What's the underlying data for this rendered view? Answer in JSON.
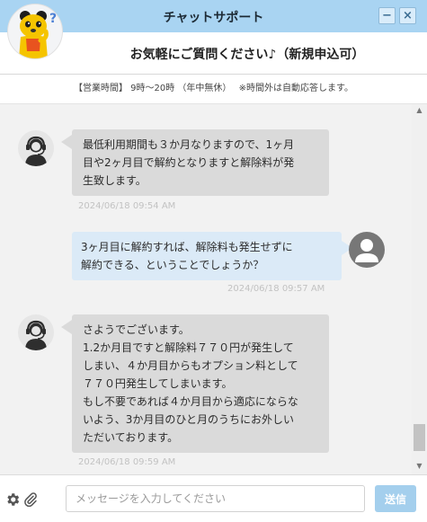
{
  "window": {
    "title": "チャットサポート",
    "minimize_glyph": "−",
    "close_glyph": "×"
  },
  "header": {
    "subtitle": "お気軽にご質問ください♪（新規申込可）",
    "mascot_icon": "bear-mascot-icon"
  },
  "hours": {
    "text": "【営業時間】 9時～20時 （年中無休）　 ※時間外は自動応答します。"
  },
  "messages": [
    {
      "sender": "operator",
      "text": "最低利用期間も３か月なりますので、1ヶ月\n目や2ヶ月目で解約となりますと解除料が発\n生致します。",
      "timestamp": "2024/06/18 09:54 AM"
    },
    {
      "sender": "user",
      "text": "3ヶ月目に解約すれば、解除料も発生せずに\n解約できる、ということでしょうか？",
      "timestamp": "2024/06/18 09:57 AM"
    },
    {
      "sender": "operator",
      "text": "さようでございます。\n1.2か月目ですと解除料７７０円が発生して\nしまい、４か月目からもオプション料として\n７７０円発生してしまいます。\nもし不要であれば４か月目から適応にならな\nいよう、3か月目のひと月のうちにお外しい\nただいております。",
      "timestamp": "2024/06/18 09:59 AM"
    }
  ],
  "footer": {
    "input_placeholder": "メッセージを入力してください",
    "input_value": "",
    "send_label": "送信"
  },
  "colors": {
    "titlebar": "#a9d4f2",
    "operator_bubble": "#dadada",
    "user_bubble": "#dbeaf7",
    "send_button": "#a4cfed",
    "chat_background": "#f2f2f2"
  }
}
